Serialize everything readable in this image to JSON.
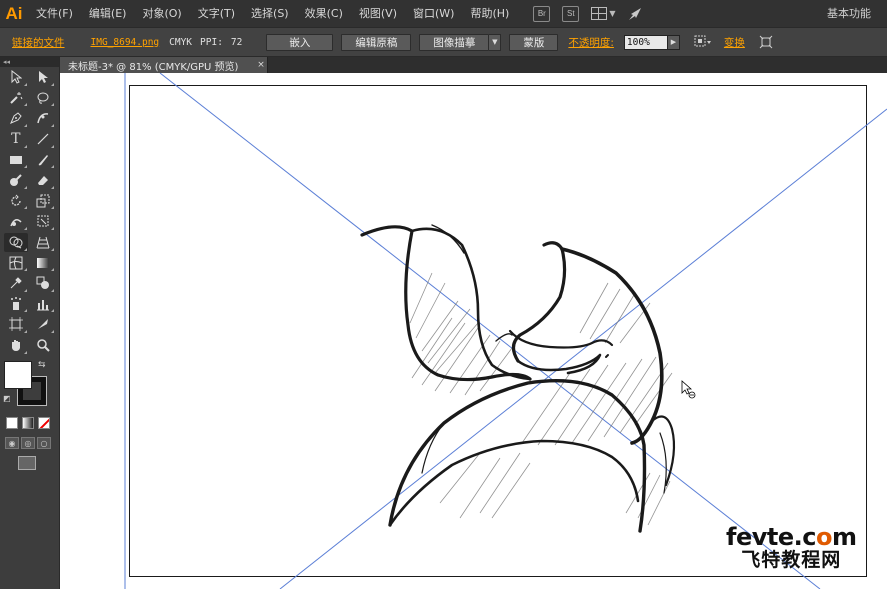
{
  "app": {
    "logo": "Ai",
    "workspace": "基本功能"
  },
  "menu": [
    "文件(F)",
    "编辑(E)",
    "对象(O)",
    "文字(T)",
    "选择(S)",
    "效果(C)",
    "视图(V)",
    "窗口(W)",
    "帮助(H)"
  ],
  "menu_icons": {
    "bridge": "Br",
    "stock": "St"
  },
  "control": {
    "linked_file": "链接的文件",
    "filename": "IMG_8694.png",
    "color_mode": "CMYK",
    "ppi_label": "PPI:",
    "ppi_value": "72",
    "embed_btn": "嵌入",
    "edit_original_btn": "编辑原稿",
    "image_trace_btn": "图像描摹",
    "mask_btn": "蒙版",
    "opacity_label": "不透明度:",
    "opacity_value": "100%",
    "transform_label": "变换"
  },
  "document": {
    "tab_title": "未标题-3* @ 81% (CMYK/GPU 预览)",
    "close": "×"
  },
  "toolbox": {
    "collapse": "◂◂"
  },
  "watermark": {
    "domain_pre": "fevte.c",
    "domain_o": "o",
    "domain_post": "m",
    "cn": "飞特教程网"
  },
  "colors": {
    "accent": "#ffa200",
    "menubar": "#323232",
    "controlbar": "#424242",
    "guide": "#5b7fd6"
  }
}
